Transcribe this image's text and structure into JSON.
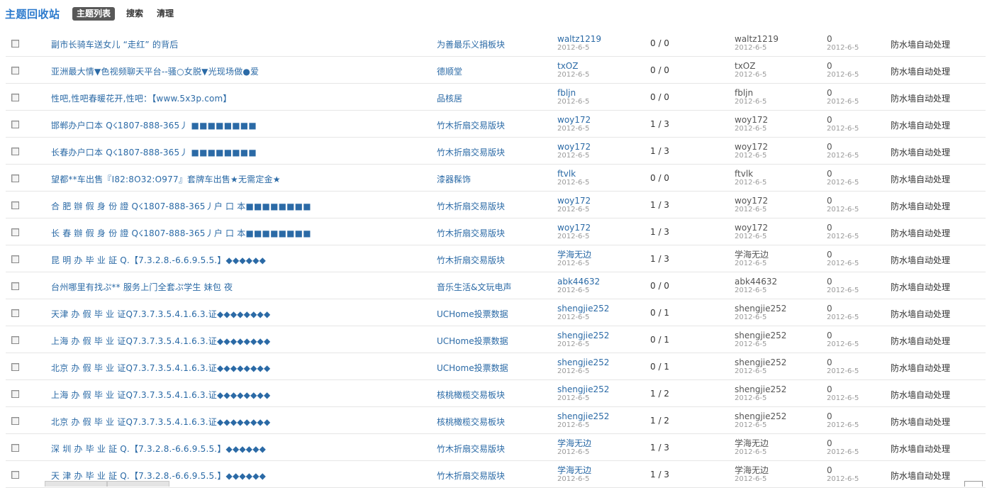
{
  "app_title": "主题回收站",
  "tabs": [
    "主题列表",
    "搜索",
    "清理"
  ],
  "rows": [
    {
      "subject": "副市长骑车送女儿 “走红” 的背后",
      "forum": "为善最乐义捐板块",
      "author": "waltz1219",
      "author_date": "2012-6-5",
      "replies": "0 / 0",
      "lastposter": "waltz1219",
      "lastposter_date": "2012-6-5",
      "deletions": "0",
      "deletions_date": "2012-6-5",
      "reason": "防水墙自动处理"
    },
    {
      "subject": "亚洲最大情▼色视频聊天平台--骚○女脱▼光现场做●爱",
      "forum": "德顺堂",
      "author": "txOZ",
      "author_date": "2012-6-5",
      "replies": "0 / 0",
      "lastposter": "txOZ",
      "lastposter_date": "2012-6-5",
      "deletions": "0",
      "deletions_date": "2012-6-5",
      "reason": "防水墙自动处理"
    },
    {
      "subject": "性吧,性吧春暖花开,性吧：【www.5x3p.com】",
      "forum": "品核居",
      "author": "fbljn",
      "author_date": "2012-6-5",
      "replies": "0 / 0",
      "lastposter": "fbljn",
      "lastposter_date": "2012-6-5",
      "deletions": "0",
      "deletions_date": "2012-6-5",
      "reason": "防水墙自动处理"
    },
    {
      "subject": "邯郸办户口本  Q☇1807-888-365丿 ■■■■■■■■",
      "forum": "竹木折扇交易版块",
      "author": "woy172",
      "author_date": "2012-6-5",
      "replies": "1 / 3",
      "lastposter": "woy172",
      "lastposter_date": "2012-6-5",
      "deletions": "0",
      "deletions_date": "2012-6-5",
      "reason": "防水墙自动处理"
    },
    {
      "subject": "长春办户口本  Q☇1807-888-365丿 ■■■■■■■■",
      "forum": "竹木折扇交易版块",
      "author": "woy172",
      "author_date": "2012-6-5",
      "replies": "1 / 3",
      "lastposter": "woy172",
      "lastposter_date": "2012-6-5",
      "deletions": "0",
      "deletions_date": "2012-6-5",
      "reason": "防水墙自动处理"
    },
    {
      "subject": "望都**车出售『I82:8O32:O977』套牌车出售★无需定金★",
      "forum": "漆器髹饰",
      "author": "ftvlk",
      "author_date": "2012-6-5",
      "replies": "0 / 0",
      "lastposter": "ftvlk",
      "lastposter_date": "2012-6-5",
      "deletions": "0",
      "deletions_date": "2012-6-5",
      "reason": "防水墙自动处理"
    },
    {
      "subject": "合 肥 辦 假 身 份 證  Q☇1807-888-365丿户 口 本■■■■■■■■",
      "forum": "竹木折扇交易版块",
      "author": "woy172",
      "author_date": "2012-6-5",
      "replies": "1 / 3",
      "lastposter": "woy172",
      "lastposter_date": "2012-6-5",
      "deletions": "0",
      "deletions_date": "2012-6-5",
      "reason": "防水墙自动处理"
    },
    {
      "subject": "长 春 辦 假 身 份 證  Q☇1807-888-365丿户 口 本■■■■■■■■",
      "forum": "竹木折扇交易版块",
      "author": "woy172",
      "author_date": "2012-6-5",
      "replies": "1 / 3",
      "lastposter": "woy172",
      "lastposter_date": "2012-6-5",
      "deletions": "0",
      "deletions_date": "2012-6-5",
      "reason": "防水墙自动处理"
    },
    {
      "subject": "昆 明 办 毕 业 証  Q.【7.3.2.8.-6.6.9.5.5.】◆◆◆◆◆◆",
      "forum": "竹木折扇交易版块",
      "author": "学海无边",
      "author_date": "2012-6-5",
      "replies": "1 / 3",
      "lastposter": "学海无边",
      "lastposter_date": "2012-6-5",
      "deletions": "0",
      "deletions_date": "2012-6-5",
      "reason": "防水墙自动处理"
    },
    {
      "subject": "台州哪里有找ぷ** 服务上门全套ぷ学生 妹包 夜",
      "forum": "音乐生活&文玩电声",
      "author": "abk44632",
      "author_date": "2012-6-5",
      "replies": "0 / 0",
      "lastposter": "abk44632",
      "lastposter_date": "2012-6-5",
      "deletions": "0",
      "deletions_date": "2012-6-5",
      "reason": "防水墙自动处理"
    },
    {
      "subject": "天津 办 假 毕 业 证Q7.3.7.3.5.4.1.6.3.证◆◆◆◆◆◆◆◆",
      "forum": "UCHome投票数据",
      "author": "shengjie252",
      "author_date": "2012-6-5",
      "replies": "0 / 1",
      "lastposter": "shengjie252",
      "lastposter_date": "2012-6-5",
      "deletions": "0",
      "deletions_date": "2012-6-5",
      "reason": "防水墙自动处理"
    },
    {
      "subject": "上海 办 假 毕 业 证Q7.3.7.3.5.4.1.6.3.证◆◆◆◆◆◆◆◆",
      "forum": "UCHome投票数据",
      "author": "shengjie252",
      "author_date": "2012-6-5",
      "replies": "0 / 1",
      "lastposter": "shengjie252",
      "lastposter_date": "2012-6-5",
      "deletions": "0",
      "deletions_date": "2012-6-5",
      "reason": "防水墙自动处理"
    },
    {
      "subject": "北京 办 假 毕 业 证Q7.3.7.3.5.4.1.6.3.证◆◆◆◆◆◆◆◆",
      "forum": "UCHome投票数据",
      "author": "shengjie252",
      "author_date": "2012-6-5",
      "replies": "0 / 1",
      "lastposter": "shengjie252",
      "lastposter_date": "2012-6-5",
      "deletions": "0",
      "deletions_date": "2012-6-5",
      "reason": "防水墙自动处理"
    },
    {
      "subject": "上海 办 假 毕 业 证Q7.3.7.3.5.4.1.6.3.证◆◆◆◆◆◆◆◆",
      "forum": "核桃橄榄交易板块",
      "author": "shengjie252",
      "author_date": "2012-6-5",
      "replies": "1 / 2",
      "lastposter": "shengjie252",
      "lastposter_date": "2012-6-5",
      "deletions": "0",
      "deletions_date": "2012-6-5",
      "reason": "防水墙自动处理"
    },
    {
      "subject": "北京 办 假 毕 业 证Q7.3.7.3.5.4.1.6.3.证◆◆◆◆◆◆◆◆",
      "forum": "核桃橄榄交易板块",
      "author": "shengjie252",
      "author_date": "2012-6-5",
      "replies": "1 / 2",
      "lastposter": "shengjie252",
      "lastposter_date": "2012-6-5",
      "deletions": "0",
      "deletions_date": "2012-6-5",
      "reason": "防水墙自动处理"
    },
    {
      "subject": "深 圳 办 毕 业 証  Q.【7.3.2.8.-6.6.9.5.5.】◆◆◆◆◆◆",
      "forum": "竹木折扇交易版块",
      "author": "学海无边",
      "author_date": "2012-6-5",
      "replies": "1 / 3",
      "lastposter": "学海无边",
      "lastposter_date": "2012-6-5",
      "deletions": "0",
      "deletions_date": "2012-6-5",
      "reason": "防水墙自动处理"
    },
    {
      "subject": "天 津 办 毕 业 証  Q.【7.3.2.8.-6.6.9.5.5.】◆◆◆◆◆◆",
      "forum": "竹木折扇交易版块",
      "author": "学海无边",
      "author_date": "2012-6-5",
      "replies": "1 / 3",
      "lastposter": "学海无边",
      "lastposter_date": "2012-6-5",
      "deletions": "0",
      "deletions_date": "2012-6-5",
      "reason": "防水墙自动处理"
    }
  ]
}
